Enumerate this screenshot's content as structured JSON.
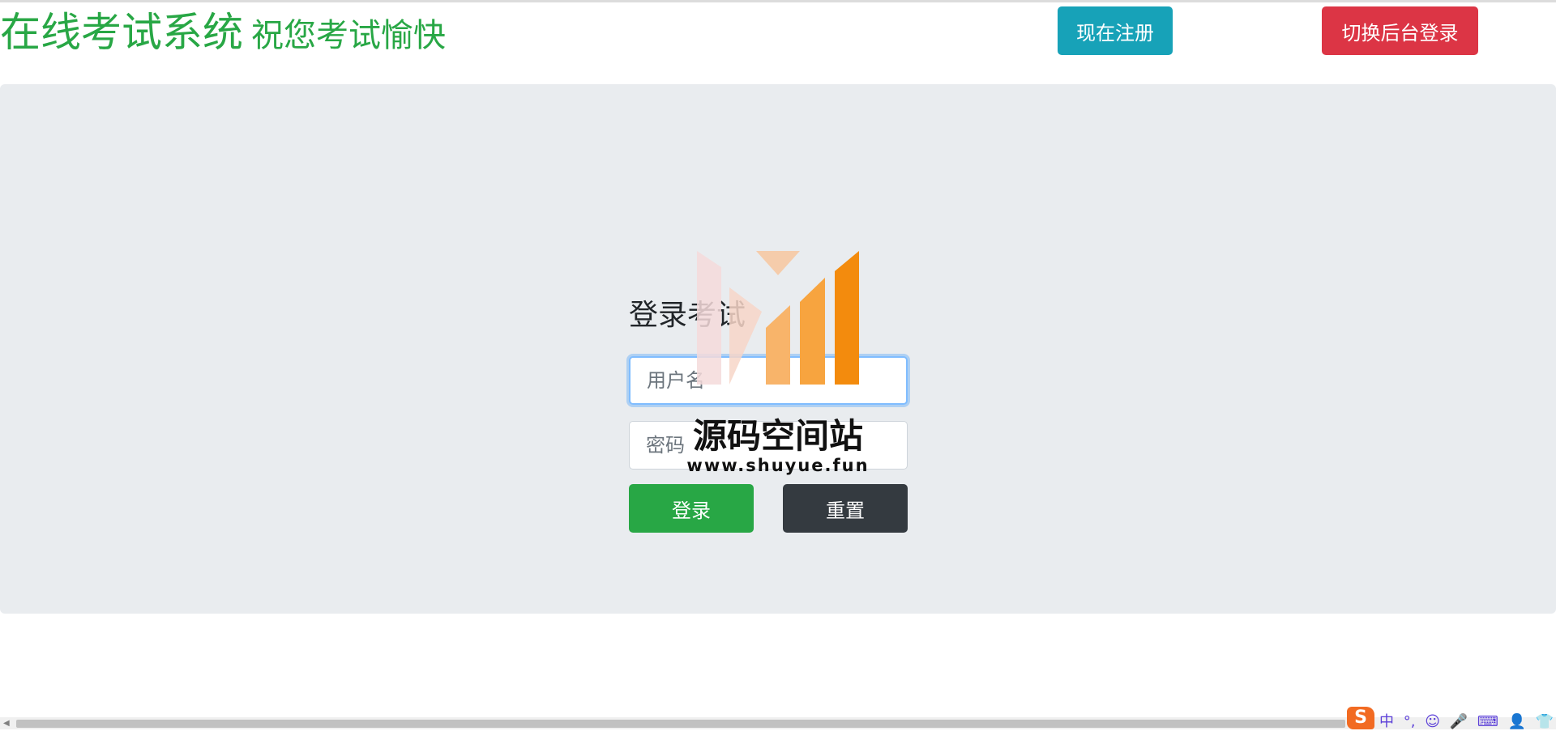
{
  "header": {
    "brand_title": "在线考试系统",
    "brand_subtitle": "祝您考试愉快",
    "register_label": "现在注册",
    "switch_admin_label": "切换后台登录"
  },
  "login": {
    "title": "登录考试",
    "username_placeholder": "用户名",
    "password_placeholder": "密码",
    "login_label": "登录",
    "reset_label": "重置"
  },
  "watermark": {
    "title": "源码空间站",
    "url": "www.shuyue.fun"
  },
  "ime": {
    "logo": "S",
    "mode": "中",
    "punct": "°,"
  },
  "colors": {
    "brand": "#28a745",
    "register": "#17a2b8",
    "switch_admin": "#dc3545",
    "login": "#28a745",
    "reset": "#343a40",
    "panel": "#e9ecef"
  }
}
